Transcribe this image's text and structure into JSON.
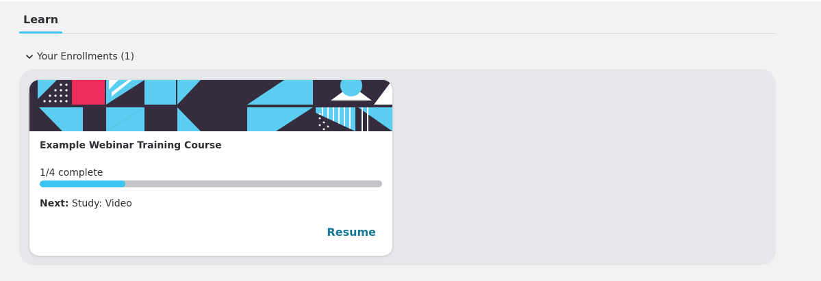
{
  "tabs": [
    {
      "label": "Learn",
      "active": true
    }
  ],
  "section": {
    "title": "Your Enrollments (1)",
    "expanded": true
  },
  "enrollments": [
    {
      "title": "Example Webinar Training Course",
      "progress_text": "1/4 complete",
      "progress_fraction": 0.25,
      "next_label": "Next:",
      "next_value": "Study: Video",
      "action_label": "Resume"
    }
  ],
  "colors": {
    "accent": "#3cc4ee",
    "link": "#127a96",
    "banner_dark": "#352d3d",
    "banner_pink": "#ec2d5a",
    "banner_blue": "#5bcdf1"
  },
  "icons": {
    "section_toggle": "chevron-down-icon"
  }
}
